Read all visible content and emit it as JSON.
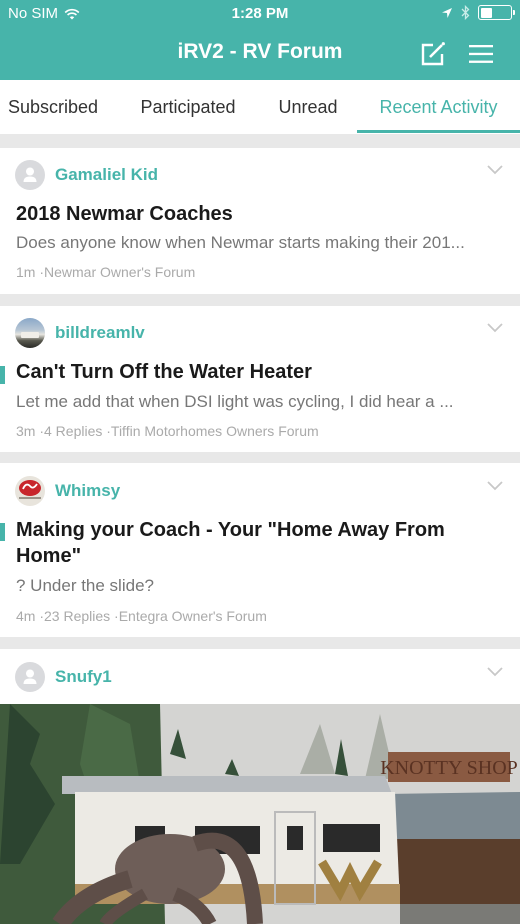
{
  "status_bar": {
    "carrier": "No SIM",
    "time": "1:28 PM",
    "battery_level": 0.4
  },
  "nav": {
    "title": "iRV2 - RV Forum",
    "compose_icon": "compose-icon",
    "menu_icon": "hamburger-menu-icon"
  },
  "tabs": [
    {
      "label": "Subscribed",
      "active": false
    },
    {
      "label": "Participated",
      "active": false
    },
    {
      "label": "Unread",
      "active": false
    },
    {
      "label": "Recent Activity",
      "active": true
    }
  ],
  "posts": [
    {
      "author": "Gamaliel Kid",
      "avatar": "default-avatar",
      "unread": false,
      "title": "2018 Newmar Coaches",
      "excerpt": "Does anyone know when Newmar starts making their 201...",
      "meta": "1m ·Newmar Owner's Forum"
    },
    {
      "author": "billdreamlv",
      "avatar": "photo-avatar",
      "unread": true,
      "title": "Can't Turn Off the Water Heater",
      "excerpt": "Let me add that when DSI light was cycling, I did hear a ...",
      "meta": "3m ·4 Replies ·Tiffin Motorhomes Owners Forum"
    },
    {
      "author": "Whimsy",
      "avatar": "integra-logo-avatar",
      "unread": true,
      "title": "Making your Coach - Your \"Home Away From Home\"",
      "excerpt": "? Under the slide?",
      "meta": "4m ·23 Replies ·Entegra Owner's Forum"
    },
    {
      "author": "Snufy1",
      "avatar": "default-avatar",
      "unread": false,
      "image": "photo of vintage motorhome and wooden sculpture in front of 'Knotty Shop' sign"
    }
  ],
  "colors": {
    "accent": "#47b4aa",
    "title_text": "#1a1a1a",
    "excerpt_text": "#777777",
    "meta_text": "#aaaaaa",
    "background": "#e8e8e8"
  }
}
